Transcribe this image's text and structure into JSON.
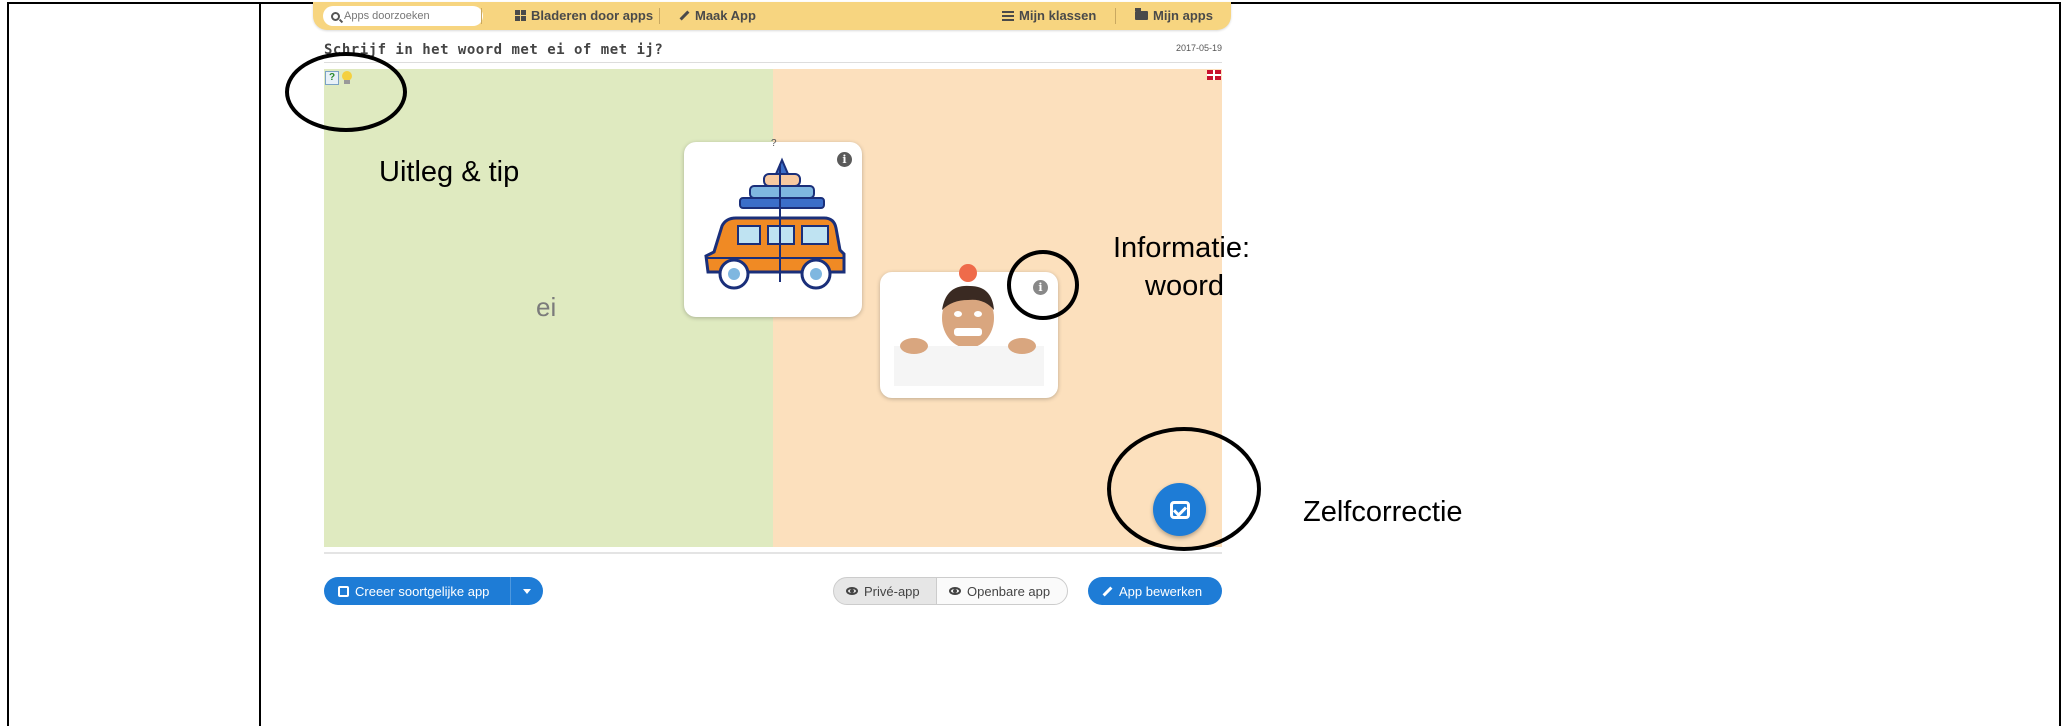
{
  "nav": {
    "search_placeholder": "Apps doorzoeken",
    "browse_label": "Bladeren door apps",
    "create_label": "Maak App",
    "classes_label": "Mijn klassen",
    "myapps_label": "Mijn apps"
  },
  "app": {
    "title": "Schrijf in het woord met ei of met ij?",
    "date": "2017-05-19",
    "help_icon_text": "?",
    "zones": [
      {
        "label": "ei"
      },
      {
        "label": ""
      }
    ],
    "cards": [
      {
        "image": "car-with-luggage",
        "question_mark": "?",
        "info": "i"
      },
      {
        "image": "person-peeking-over-wall",
        "info": "i"
      }
    ]
  },
  "annotations": {
    "uitleg": "Uitleg & tip",
    "info_line1": "Informatie:",
    "info_line2": "woord",
    "zelfcorrectie": "Zelfcorrectie"
  },
  "footer": {
    "create_similar": "Creeer soortgelijke app",
    "private": "Privé-app",
    "public": "Openbare app",
    "edit": "App bewerken"
  },
  "colors": {
    "nav_bg": "#f7d580",
    "zone_ei": "#dfeac0",
    "zone_ij": "#fce0bd",
    "button_blue": "#1e7cd6"
  }
}
